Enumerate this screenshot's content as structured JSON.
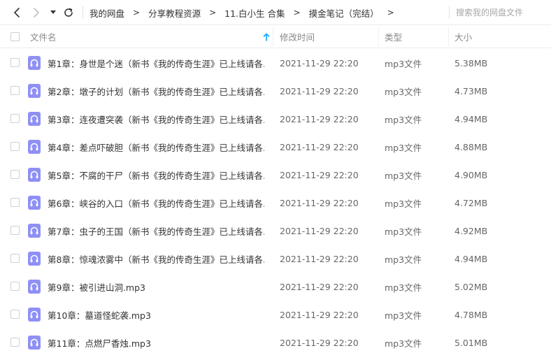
{
  "toolbar": {
    "breadcrumbs": [
      "我的网盘",
      "分享教程资源",
      "11.白小生 合集",
      "摸金笔记（完结）"
    ],
    "search_placeholder": "搜索我的网盘文件"
  },
  "columns": {
    "name": "文件名",
    "modified": "修改时间",
    "type": "类型",
    "size": "大小",
    "sort_direction": "ascending"
  },
  "colors": {
    "accent": "#06a7ff",
    "file_icon": "#8f8ff7",
    "text": "#333333",
    "muted": "#888888"
  },
  "icons": {
    "back": "chevron-left-icon",
    "forward": "chevron-right-icon",
    "history": "caret-down-icon",
    "refresh": "refresh-icon",
    "sort": "arrow-up-icon",
    "file": "audio-file-icon"
  },
  "files": [
    {
      "name": "第1章：身世是个迷（新书《我的传奇生涯》已上线请各...",
      "modified": "2021-11-29 22:20",
      "type": "mp3文件",
      "size": "5.38MB"
    },
    {
      "name": "第2章：墩子的计划（新书《我的传奇生涯》已上线请各...",
      "modified": "2021-11-29 22:20",
      "type": "mp3文件",
      "size": "4.73MB"
    },
    {
      "name": "第3章：连夜遭突袭（新书《我的传奇生涯》已上线请各...",
      "modified": "2021-11-29 22:20",
      "type": "mp3文件",
      "size": "4.94MB"
    },
    {
      "name": "第4章：差点吓破胆（新书《我的传奇生涯》已上线请各...",
      "modified": "2021-11-29 22:20",
      "type": "mp3文件",
      "size": "4.88MB"
    },
    {
      "name": "第5章：不腐的干尸（新书《我的传奇生涯》已上线请各...",
      "modified": "2021-11-29 22:20",
      "type": "mp3文件",
      "size": "4.90MB"
    },
    {
      "name": "第6章：峡谷的入口（新书《我的传奇生涯》已上线请各...",
      "modified": "2021-11-29 22:20",
      "type": "mp3文件",
      "size": "4.72MB"
    },
    {
      "name": "第7章：虫子的王国（新书《我的传奇生涯》已上线请各...",
      "modified": "2021-11-29 22:20",
      "type": "mp3文件",
      "size": "4.92MB"
    },
    {
      "name": "第8章：惊魂浓雾中（新书《我的传奇生涯》已上线请各...",
      "modified": "2021-11-29 22:20",
      "type": "mp3文件",
      "size": "4.94MB"
    },
    {
      "name": "第9章：被引进山洞.mp3",
      "modified": "2021-11-29 22:20",
      "type": "mp3文件",
      "size": "5.02MB"
    },
    {
      "name": "第10章：墓道怪蛇袭.mp3",
      "modified": "2021-11-29 22:20",
      "type": "mp3文件",
      "size": "4.78MB"
    },
    {
      "name": "第11章：点燃尸香烛.mp3",
      "modified": "2021-11-29 22:20",
      "type": "mp3文件",
      "size": "5.01MB"
    }
  ]
}
